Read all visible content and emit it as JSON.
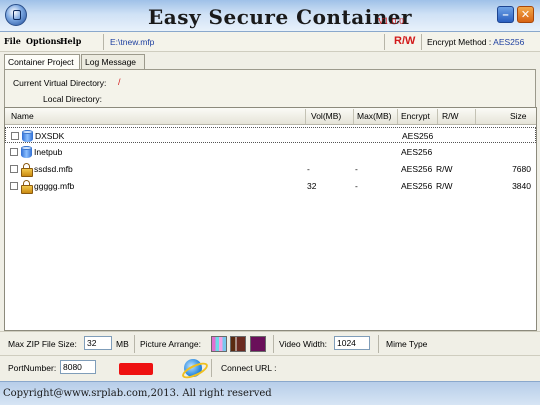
{
  "window": {
    "title": "Easy Secure Container",
    "version": "V1.0.0",
    "minimize_symbol": "–",
    "close_symbol": "✕"
  },
  "menu": {
    "file": "File",
    "options": "Options",
    "help": "Help"
  },
  "status": {
    "file_path": "E:\\tnew.mfp",
    "rw_flag": "R/W",
    "encrypt_method_label": "Encrypt Method :",
    "encrypt_method_value": "AES256"
  },
  "tabs": [
    {
      "label": "Container Project",
      "active": true
    },
    {
      "label": "Log Message",
      "active": false
    }
  ],
  "project": {
    "current_dir_label": "Current Virtual Directory:",
    "current_dir_value": "/",
    "local_dir_label": "Local Directory:"
  },
  "list": {
    "columns": [
      "Name",
      "Vol(MB)",
      "Max(MB)",
      "Encrypt",
      "R/W",
      "Size"
    ],
    "rows": [
      {
        "name": "DXSDK",
        "icon": "database-icon",
        "vol": "",
        "max": "",
        "encrypt": "AES256",
        "rw": "",
        "size": "",
        "selected": true
      },
      {
        "name": "Inetpub",
        "icon": "database-icon",
        "vol": "",
        "max": "",
        "encrypt": "AES256",
        "rw": "",
        "size": "",
        "selected": false
      },
      {
        "name": "ssdsd.mfb",
        "icon": "lock-icon",
        "vol": "-",
        "max": "-",
        "encrypt": "AES256",
        "rw": "R/W",
        "size": "7680",
        "selected": false
      },
      {
        "name": "ggggg.mfb",
        "icon": "lock-icon",
        "vol": "32",
        "max": "-",
        "encrypt": "AES256",
        "rw": "R/W",
        "size": "3840",
        "selected": false
      }
    ]
  },
  "settings": {
    "max_zip_label": "Max ZIP File Size:",
    "max_zip_value": "32",
    "max_zip_unit": "MB",
    "picture_arrange_label": "Picture Arrange:",
    "video_width_label": "Video Width:",
    "video_width_value": "1024",
    "mime_type_label": "Mime Type",
    "port_label": "PortNumber:",
    "port_value": "8080",
    "connect_url_label": "Connect URL :"
  },
  "footer": {
    "copyright": "Copyright@www.srplab.com,2013. All right reserved"
  },
  "colors": {
    "accent_red": "#d21a1a",
    "link_blue": "#1d3fa0",
    "indicator_red": "#ee1111"
  }
}
